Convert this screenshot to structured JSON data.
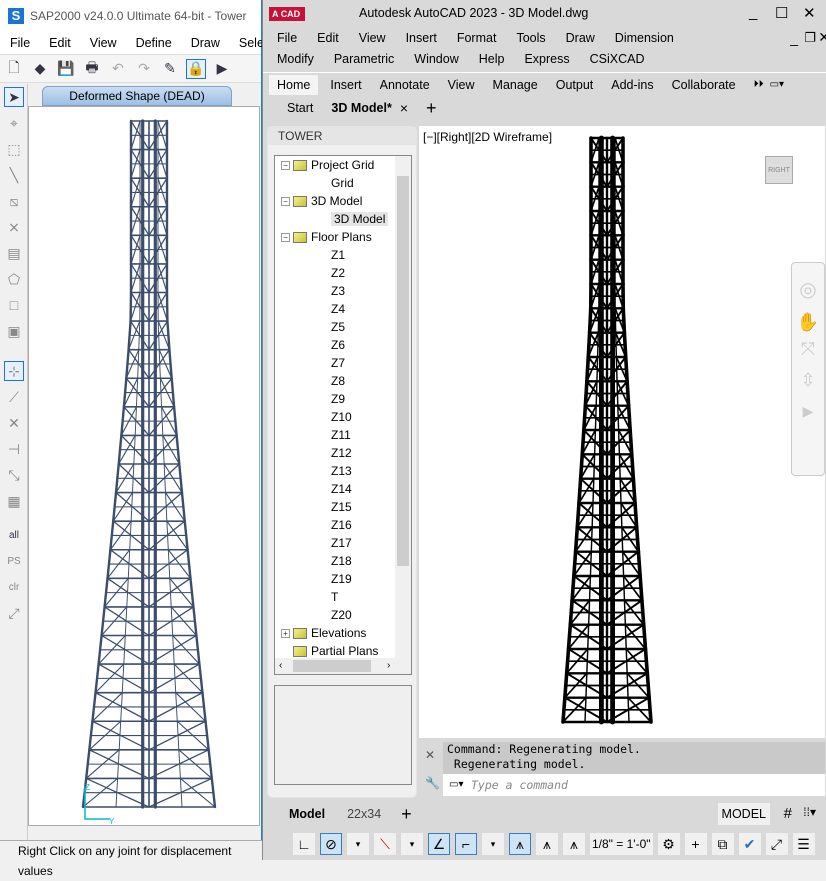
{
  "sap": {
    "title": "SAP2000 v24.0.0 Ultimate 64-bit - Tower",
    "logo": "S",
    "menu": [
      "File",
      "Edit",
      "View",
      "Define",
      "Draw",
      "Sele"
    ],
    "toolbar_icons": [
      "new-file-icon",
      "open-icon",
      "save-icon",
      "print-icon",
      "undo-icon",
      "redo-icon",
      "pencil-icon",
      "lock-icon",
      "play-icon"
    ],
    "left_tools": [
      "pointer-icon",
      "reshape-icon",
      "point-select-icon",
      "line-icon",
      "line-select-icon",
      "cross-select-icon",
      "grid-select-icon",
      "polygon-icon",
      "rectangle-icon",
      "area-select-icon",
      "joint-icon",
      "joint-chain-icon",
      "intersect-icon",
      "joint-on-line-icon",
      "diagonal-joint-icon",
      "grid-joint-icon",
      "select-all-icon",
      "previous-selection-icon",
      "clear-selection-icon",
      "intersecting-line-icon"
    ],
    "select_tools": {
      "all": "all",
      "ps": "PS",
      "clr": "clr"
    },
    "view_tab": "Deformed Shape (DEAD)",
    "axis": {
      "z": "Z",
      "y": "Y"
    },
    "status": "Right Click on any joint for displacement values",
    "tower_color": "#3c4d6b"
  },
  "acad": {
    "logo": "A",
    "logo_sub": "CAD",
    "title": "Autodesk AutoCAD 2023 -   3D Model.dwg",
    "window_buttons": {
      "min": "_",
      "max": "☐",
      "close": "✕",
      "restore": "🗗"
    },
    "menu_row1": [
      "File",
      "Edit",
      "View",
      "Insert",
      "Format",
      "Tools",
      "Draw",
      "Dimension"
    ],
    "menu_row2": [
      "Modify",
      "Parametric",
      "Window",
      "Help",
      "Express",
      "CSiXCAD"
    ],
    "ribbon_tabs": [
      "Home",
      "Insert",
      "Annotate",
      "View",
      "Manage",
      "Output",
      "Add-ins",
      "Collaborate"
    ],
    "ribbon_active": "Home",
    "doc_tabs": {
      "start": "Start",
      "active": "3D Model*",
      "close": "×",
      "add": "+"
    },
    "panel": {
      "title": "TOWER",
      "tree": [
        {
          "label": "Project Grid",
          "level": 0,
          "expander": "−",
          "children": [
            "Grid"
          ]
        },
        {
          "label": "3D Model",
          "level": 0,
          "expander": "−",
          "children": [
            "3D Model"
          ],
          "selected_child": "3D Model"
        },
        {
          "label": "Floor Plans",
          "level": 0,
          "expander": "−",
          "children": [
            "Z1",
            "Z2",
            "Z3",
            "Z4",
            "Z5",
            "Z6",
            "Z7",
            "Z8",
            "Z9",
            "Z10",
            "Z11",
            "Z12",
            "Z13",
            "Z14",
            "Z15",
            "Z16",
            "Z17",
            "Z18",
            "Z19",
            "T",
            "Z20"
          ]
        },
        {
          "label": "Elevations",
          "level": 0,
          "expander": "+",
          "children": []
        },
        {
          "label": "Partial Plans",
          "level": 0,
          "expander": "",
          "children": []
        }
      ]
    },
    "viewport": {
      "label": "[−][Right][2D Wireframe]",
      "viewcube": "RIGHT"
    },
    "command": {
      "history": [
        "Command: Regenerating model.",
        " Regenerating model."
      ],
      "placeholder": "Type a command"
    },
    "layout_tabs": [
      "Model",
      "22x34"
    ],
    "layout_add": "+",
    "model_label": "MODEL",
    "scale": "1/8\" = 1'-0\""
  }
}
